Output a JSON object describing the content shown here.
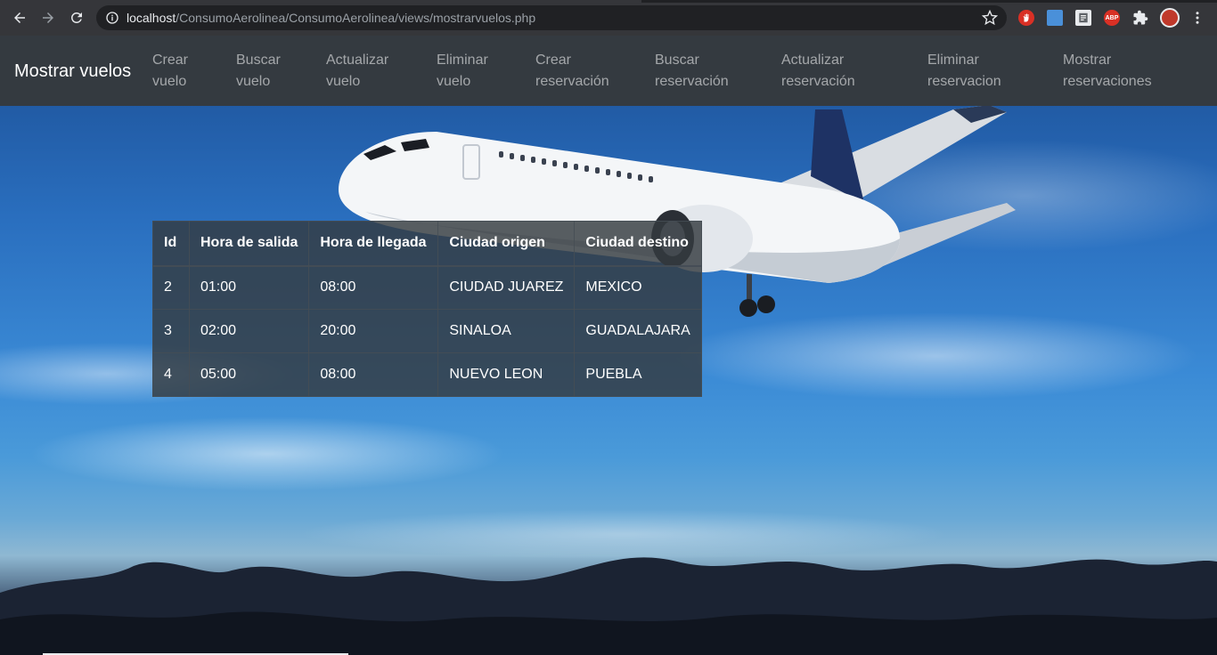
{
  "browser": {
    "url_host": "localhost",
    "url_path": "/ConsumoAerolinea/ConsumoAerolinea/views/mostrarvuelos.php",
    "extensions": [
      {
        "name": "stop-extension-icon",
        "color": "#d93025",
        "label": ""
      },
      {
        "name": "screen-extension-icon",
        "color": "#4a90d9",
        "label": ""
      },
      {
        "name": "document-extension-icon",
        "color": "#5f6368",
        "label": ""
      },
      {
        "name": "adblock-extension-icon",
        "color": "#d93025",
        "label": "ABP"
      },
      {
        "name": "puzzle-extension-icon",
        "color": "#e8eaed",
        "label": ""
      },
      {
        "name": "profile-avatar-icon",
        "color": "#c0392b",
        "label": ""
      }
    ]
  },
  "navbar": {
    "brand": "Mostrar vuelos",
    "links": [
      {
        "line1": "Crear",
        "line2": "vuelo"
      },
      {
        "line1": "Buscar",
        "line2": "vuelo"
      },
      {
        "line1": "Actualizar",
        "line2": "vuelo"
      },
      {
        "line1": "Eliminar",
        "line2": "vuelo"
      },
      {
        "line1": "Crear",
        "line2": "reservación"
      },
      {
        "line1": "Buscar",
        "line2": "reservación"
      },
      {
        "line1": "Actualizar",
        "line2": "reservación"
      },
      {
        "line1": "Eliminar",
        "line2": "reservacion"
      },
      {
        "line1": "Mostrar",
        "line2": "reservaciones"
      }
    ]
  },
  "table": {
    "headers": [
      "Id",
      "Hora de salida",
      "Hora de llegada",
      "Ciudad origen",
      "Ciudad destino"
    ],
    "rows": [
      [
        "2",
        "01:00",
        "08:00",
        "CIUDAD JUAREZ",
        "MEXICO"
      ],
      [
        "3",
        "02:00",
        "20:00",
        "SINALOA",
        "GUADALAJARA"
      ],
      [
        "4",
        "05:00",
        "08:00",
        "NUEVO LEON",
        "PUEBLA"
      ]
    ]
  },
  "colors": {
    "navbar_bg": "#343a40",
    "table_bg": "#343a40",
    "nav_link": "rgba(255,255,255,0.55)",
    "brand": "#ffffff"
  }
}
